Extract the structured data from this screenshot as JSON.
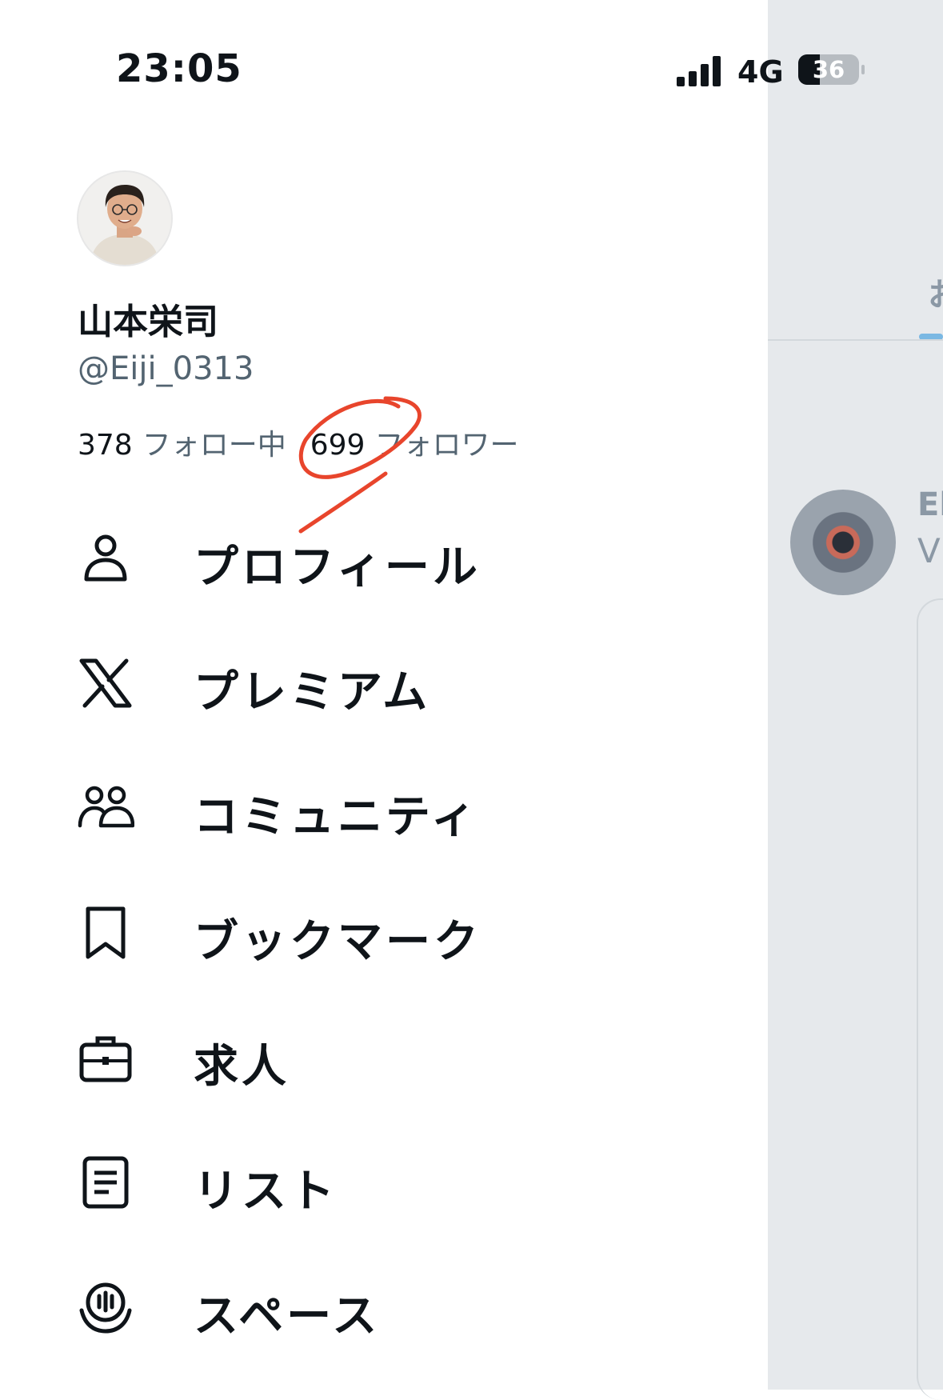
{
  "status_bar": {
    "time": "23:05",
    "network": "4G",
    "battery_percent": "36",
    "battery_level": 0.36
  },
  "profile": {
    "display_name": "山本栄司",
    "handle": "@Eiji_0313",
    "following_count": "378",
    "following_label": "フォロー中",
    "followers_count": "699",
    "followers_label": "フォロワー",
    "annotation_color": "#e8452c"
  },
  "menu": {
    "items": [
      {
        "label": "プロフィール",
        "icon": "person-icon"
      },
      {
        "label": "プレミアム",
        "icon": "x-logo-icon"
      },
      {
        "label": "コミュニティ",
        "icon": "people-icon"
      },
      {
        "label": "ブックマーク",
        "icon": "bookmark-icon"
      },
      {
        "label": "求人",
        "icon": "briefcase-icon"
      },
      {
        "label": "リスト",
        "icon": "list-icon"
      },
      {
        "label": "スペース",
        "icon": "microphone-icon"
      }
    ]
  },
  "background_timeline": {
    "tab_fragment": "お",
    "name_fragment": "El",
    "sub_fragment": "V("
  }
}
